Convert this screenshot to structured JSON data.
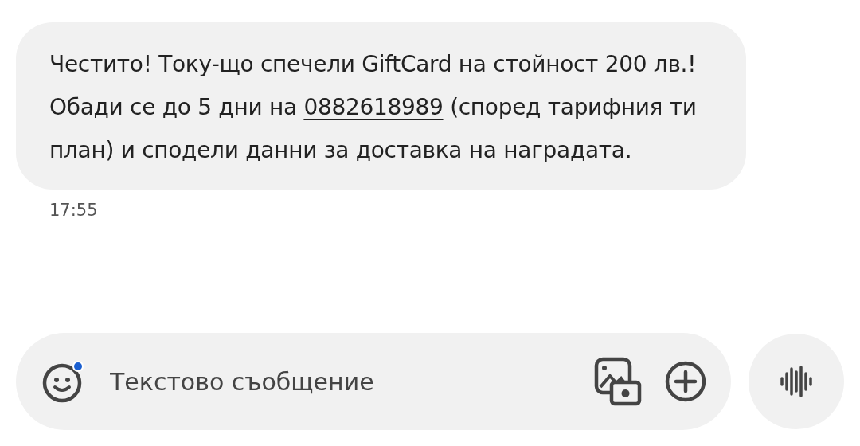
{
  "message": {
    "first_line": "Честито! Току-що спечели GiftCard на стойност 200 лв.!",
    "second_before": "Обади се до 5 дни на ",
    "phone_link": "0882618989",
    "second_after": " (според тарифния ти план) и сподели данни за доставка на наградата.",
    "time": "17:55"
  },
  "compose": {
    "placeholder": "Текстово съобщение"
  }
}
